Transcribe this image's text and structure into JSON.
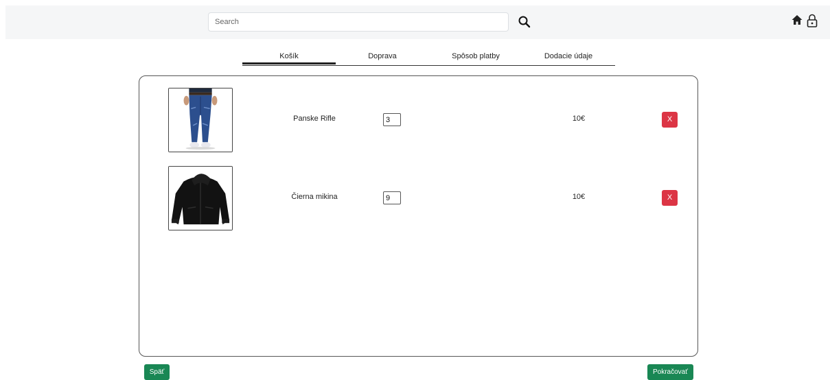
{
  "header": {
    "search_placeholder": "Search",
    "icons": [
      "search-icon",
      "home-icon",
      "lock-icon"
    ]
  },
  "steps": [
    {
      "label": "Košík",
      "active": true
    },
    {
      "label": "Doprava",
      "active": false
    },
    {
      "label": "Spôsob platby",
      "active": false
    },
    {
      "label": "Dodacie údaje",
      "active": false
    }
  ],
  "cart": {
    "items": [
      {
        "name": "Panske Rifle",
        "quantity": "3",
        "price": "10€",
        "remove_label": "X",
        "image": "jeans-image"
      },
      {
        "name": "Čierna mikina",
        "quantity": "9",
        "price": "10€",
        "remove_label": "X",
        "image": "hoodie-image"
      }
    ]
  },
  "footer": {
    "back_label": "Späť",
    "next_label": "Pokračovať"
  },
  "colors": {
    "topbar": "#f5f6f7",
    "danger": "#dc3545",
    "success": "#198754"
  }
}
